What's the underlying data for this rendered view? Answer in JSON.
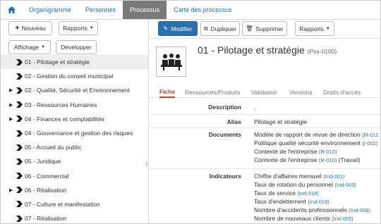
{
  "nav": {
    "tabs": [
      {
        "label": "Organigramme"
      },
      {
        "label": "Personnes"
      },
      {
        "label": "Processus"
      },
      {
        "label": "Carte des processus"
      }
    ]
  },
  "left": {
    "new_label": "Nouveau",
    "reports_label": "Rapports",
    "display_label": "Affichage",
    "expand_label": "Développer",
    "tree": [
      {
        "label": "01 - Pilotage et stratégie",
        "expandable": false,
        "selected": true
      },
      {
        "label": "02 - Gestion du conseil municipal",
        "expandable": false
      },
      {
        "label": "02 - Qualité, Sécurité et Environnement",
        "expandable": true
      },
      {
        "label": "03 - Ressources Humaines",
        "expandable": true
      },
      {
        "label": "04 - Finances et comptabilités",
        "expandable": true
      },
      {
        "label": "04 - Gouvernance et gestion des risques",
        "expandable": false
      },
      {
        "label": "05 - Accueil du public",
        "expandable": false
      },
      {
        "label": "05 - Juridique",
        "expandable": false
      },
      {
        "label": "06 - Commercial",
        "expandable": false
      },
      {
        "label": "06 - Réalisation",
        "expandable": true
      },
      {
        "label": "07 - Culture et manifestation",
        "expandable": false
      },
      {
        "label": "07 - Réalisation",
        "expandable": false
      }
    ]
  },
  "toolbar": {
    "edit_label": "Modifier",
    "duplicate_label": "Dupliquer",
    "delete_label": "Supprimer",
    "reports_label": "Rapports"
  },
  "detail": {
    "title": "01 - Pilotage et stratégie",
    "code": "(Pss-0100)",
    "tabs": [
      "Fiche",
      "Ressources/Produits",
      "Validation",
      "Versions",
      "Droits d'accès"
    ],
    "description_label": "Description",
    "description_value": ".",
    "alias_label": "Alias",
    "alias_value": "Pilotage et stratégie",
    "documents_label": "Documents",
    "documents": [
      {
        "name": "Modèle de rapport de revue de direction",
        "ref": "(M-011"
      },
      {
        "name": "Politique qualité sécurité environnement",
        "ref": "(I-002)"
      },
      {
        "name": "Contexte de l'entreprise",
        "ref": "(R-010)"
      },
      {
        "name": "Contexte de l'entreprise",
        "ref": "(R-010)",
        "extra": "(Travail)"
      }
    ],
    "indicators_label": "Indicateurs",
    "indicators": [
      {
        "name": "Chiffre d'affaires mensuel",
        "ref": "(Ind-001)"
      },
      {
        "name": "Taux de rotation du personnel",
        "ref": "(Ind-003)"
      },
      {
        "name": "Taux de service",
        "ref": "(Ind-018)"
      },
      {
        "name": "Taux d'endettement",
        "ref": "(Ind-019)"
      },
      {
        "name": "Nombre d'accidents professionnels",
        "ref": "(Ind-009)"
      },
      {
        "name": "Nombre de nouveaux clients",
        "ref": "(Ind-005)"
      }
    ]
  },
  "colors": {
    "accent": "#2a6fb0",
    "active_tab": "#c9412b",
    "nav_active_bg": "#7a7a7a"
  }
}
